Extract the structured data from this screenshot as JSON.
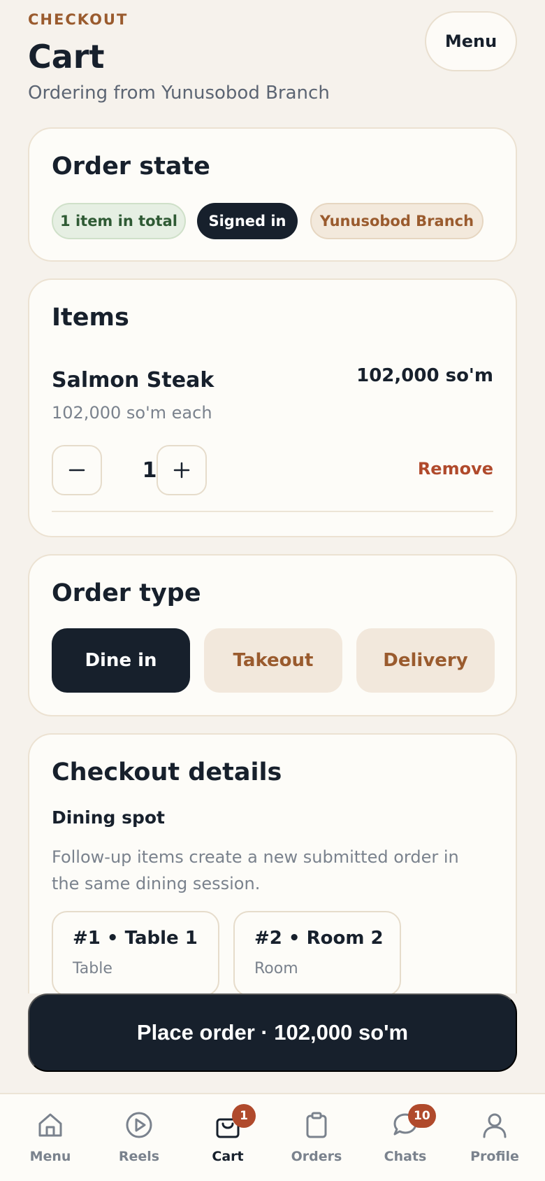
{
  "header": {
    "eyebrow": "CHECKOUT",
    "title": "Cart",
    "subtitle": "Ordering from Yunusobod Branch",
    "menu_label": "Menu"
  },
  "order_state": {
    "title": "Order state",
    "pills": [
      "1 item in total",
      "Signed in",
      "Yunusobod Branch"
    ]
  },
  "items": {
    "title": "Items",
    "list": [
      {
        "name": "Salmon Steak",
        "price": "102,000 so'm",
        "each": "102,000 so'm each",
        "quantity": "1",
        "remove_label": "Remove"
      }
    ]
  },
  "order_type": {
    "title": "Order type",
    "options": [
      "Dine in",
      "Takeout",
      "Delivery"
    ],
    "selected": "Dine in"
  },
  "checkout_details": {
    "title": "Checkout details",
    "section_label": "Dining spot",
    "hint": "Follow-up items create a new submitted order in the same dining session.",
    "spots": [
      {
        "title": "#1 • Table 1",
        "sub": "Table"
      },
      {
        "title": "#2 • Room 2",
        "sub": "Room"
      }
    ]
  },
  "place_order_label": "Place order · 102,000 so'm",
  "nav": {
    "items": [
      {
        "label": "Menu",
        "icon": "home-icon"
      },
      {
        "label": "Reels",
        "icon": "play-icon"
      },
      {
        "label": "Cart",
        "icon": "bag-icon",
        "badge": "1"
      },
      {
        "label": "Orders",
        "icon": "clipboard-icon"
      },
      {
        "label": "Chats",
        "icon": "chat-icon",
        "badge": "10"
      },
      {
        "label": "Profile",
        "icon": "user-icon"
      }
    ],
    "active": "Cart"
  },
  "colors": {
    "background": "#f6f2ec",
    "dark": "#17202c",
    "accent_brown": "#9a5b2e",
    "danger": "#b04a2c"
  }
}
